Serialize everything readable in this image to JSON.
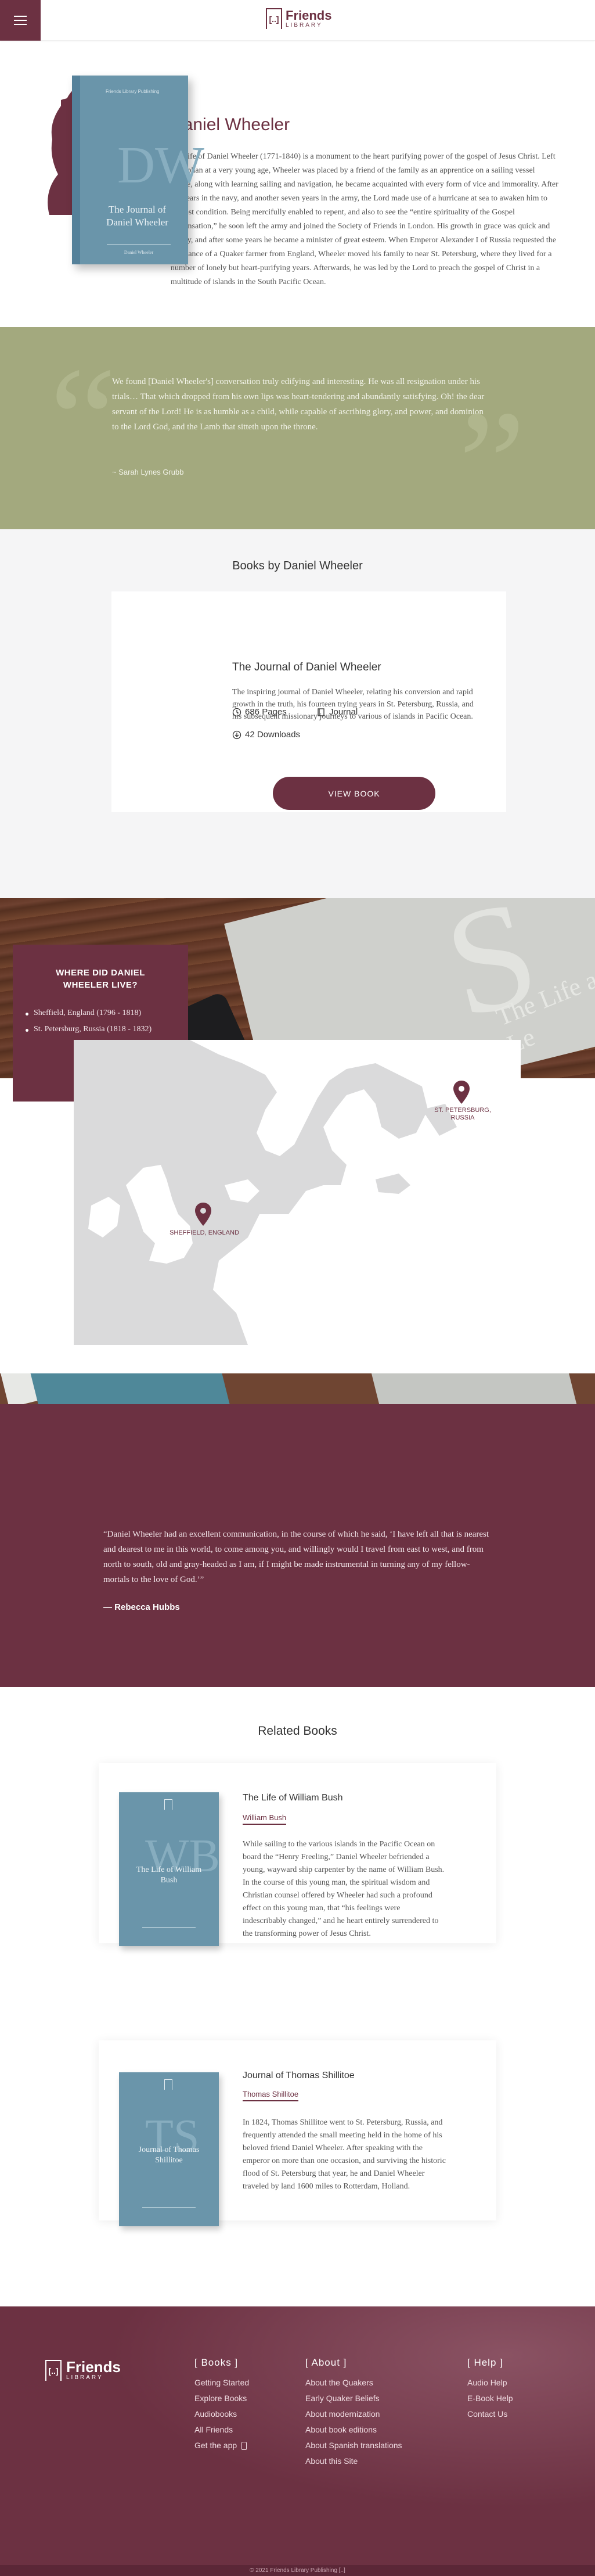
{
  "header": {
    "logo_mark": "[..]",
    "logo_word": "Friends",
    "logo_sub": "LIBRARY"
  },
  "author": {
    "name": "Daniel Wheeler",
    "bio": "The life of Daniel Wheeler (1771-1840) is a monument to the heart purifying power of the gospel of Jesus Christ. Left an orphan at a very young age, Wheeler was placed by a friend of the family as an apprentice on a sailing vessel where, along with learning sailing and navigation, he became acquainted with every form of vice and immorality. After six years in the navy, and another seven years in the army, the Lord made use of a hurricane at sea to awaken him to his lost condition. Being mercifully enabled to repent, and also to see the “entire spirituality of the Gospel dispensation,” he soon left the army and joined the Society of Friends in London. His growth in grace was quick and steady, and after some years he became a minister of great esteem. When Emperor Alexander I of Russia requested the assistance of a Quaker farmer from England, Wheeler moved his family to near St. Petersburg, where they lived for a number of lonely but heart-purifying years. Afterwards, he was led by the Lord to preach the gospel of Christ in a multitude of islands in the South Pacific Ocean."
  },
  "quote1": {
    "text": "We found [Daniel Wheeler's] conversation truly edifying and interesting. He was all resignation under his trials… That which dropped from his own lips was heart-tendering and abundantly satisfying. Oh! the dear servant of the Lord! He is as humble as a child, while capable of ascribing glory, and power, and dominion to the Lord God, and the Lamb that sitteth upon the throne.",
    "cite": "~ Sarah Lynes Grubb"
  },
  "books": {
    "heading": "Books by Daniel Wheeler",
    "cover_caption": "Friends Library Publishing",
    "cover_letters": "DW",
    "cover_title": "The Journal of Daniel Wheeler",
    "cover_by": "Daniel Wheeler",
    "title": "The Journal of Daniel Wheeler",
    "description": "The inspiring journal of Daniel Wheeler, relating his conversion and rapid growth in the truth, his fourteen trying years in St. Petersburg, Russia, and his subsequent missionary journeys to various of islands in Pacific Ocean.",
    "pages": "686 Pages",
    "format": "Journal",
    "downloads": "42 Downloads",
    "button": "VIEW BOOK"
  },
  "where": {
    "title": "WHERE DID DANIEL WHEELER LIVE?",
    "places": [
      "Sheffield, England (1796 - 1818)",
      "St. Petersburg, Russia (1818 - 1832)"
    ],
    "map_labels": [
      "SHEFFIELD, ENGLAND",
      "ST. PETERSBURG, RUSSIA"
    ],
    "book_letter": "S",
    "book_spine": "The Life and Le"
  },
  "quote2": {
    "text": "“Daniel Wheeler had an excellent communication, in the course of which he said, ‘I have left all that is nearest and dearest to me in this world, to come among you, and willingly would I travel from east to west, and from north to south, old and gray-headed as I am, if I might be made instrumental in turning any of my fellow-mortals to the love of God.’”",
    "cite": "— Rebecca Hubbs"
  },
  "related": {
    "heading": "Related Books",
    "books": [
      {
        "cover_letters": "WB",
        "cover_title": "The Life of William Bush",
        "title": "The Life of William Bush",
        "author": "William Bush",
        "description": "While sailing to the various islands in the Pacific Ocean on board the “Henry Freeling,” Daniel Wheeler befriended a young, wayward ship carpenter by the name of William Bush. In the course of this young man, the spiritual wisdom and Christian counsel offered by Wheeler had such a profound effect on this young man, that “his feelings were indescribably changed,” and he heart entirely surrendered to the transforming power of Jesus Christ."
      },
      {
        "cover_letters": "TS",
        "cover_title": "Journal of Thomas Shillitoe",
        "title": "Journal of Thomas Shillitoe",
        "author": "Thomas Shillitoe",
        "description": "In 1824, Thomas Shillitoe went to St. Petersburg, Russia, and frequently attended the small meeting held in the home of his beloved friend Daniel Wheeler. After speaking with the emperor on more than one occasion, and surviving the historic flood of St. Petersburg that year, he and Daniel Wheeler traveled by land 1600 miles to Rotterdam, Holland."
      }
    ]
  },
  "footer": {
    "books_heading": "[ Books ]",
    "books_links": [
      "Getting Started",
      "Explore Books",
      "Audiobooks",
      "All Friends",
      "Get the app"
    ],
    "about_heading": "[ About ]",
    "about_links": [
      "About the Quakers",
      "Early Quaker Beliefs",
      "About modernization",
      "About book editions",
      "About Spanish translations",
      "About this Site"
    ],
    "help_heading": "[ Help ]",
    "help_links": [
      "Audio Help",
      "E-Book Help",
      "Contact Us"
    ],
    "copyright": "© 2021 Friends Library Publishing [..]"
  },
  "colors": {
    "brand": "#6c3142",
    "olive": "#a3a97e",
    "cover": "#6a95aa"
  }
}
